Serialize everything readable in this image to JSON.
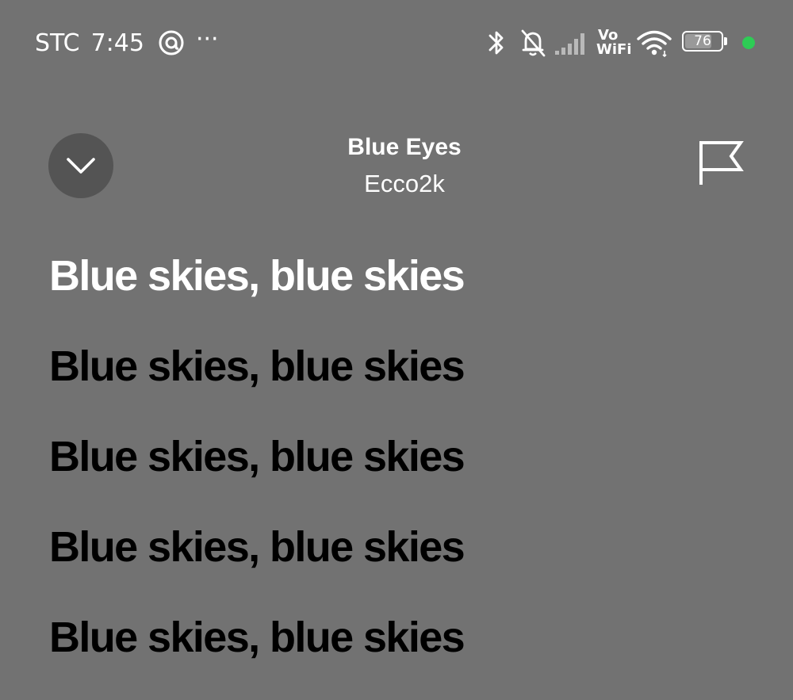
{
  "status_bar": {
    "carrier": "STC",
    "time": "7:45",
    "more": "···",
    "vowifi_top": "Vo",
    "vowifi_bottom": "WiFi",
    "battery_percent": "76",
    "battery_level": 0.76,
    "indicator_dot_color": "#2ecc55",
    "icons": [
      "threads-icon",
      "more-icon",
      "bluetooth-icon",
      "notifications-off-icon",
      "signal-icon",
      "wifi-icon",
      "battery-icon"
    ]
  },
  "header": {
    "collapse_icon": "chevron-down-icon",
    "track_title": "Blue Eyes",
    "artist": "Ecco2k",
    "report_icon": "flag-icon"
  },
  "lyrics": {
    "lines": [
      "Blue skies, blue skies",
      "Blue skies, blue skies",
      "Blue skies, blue skies",
      "Blue skies, blue skies",
      "Blue skies, blue skies"
    ],
    "active_index": 0
  },
  "colors": {
    "background": "#727272",
    "button_background": "#545454",
    "active_lyric": "#ffffff",
    "inactive_lyric": "#000000"
  }
}
